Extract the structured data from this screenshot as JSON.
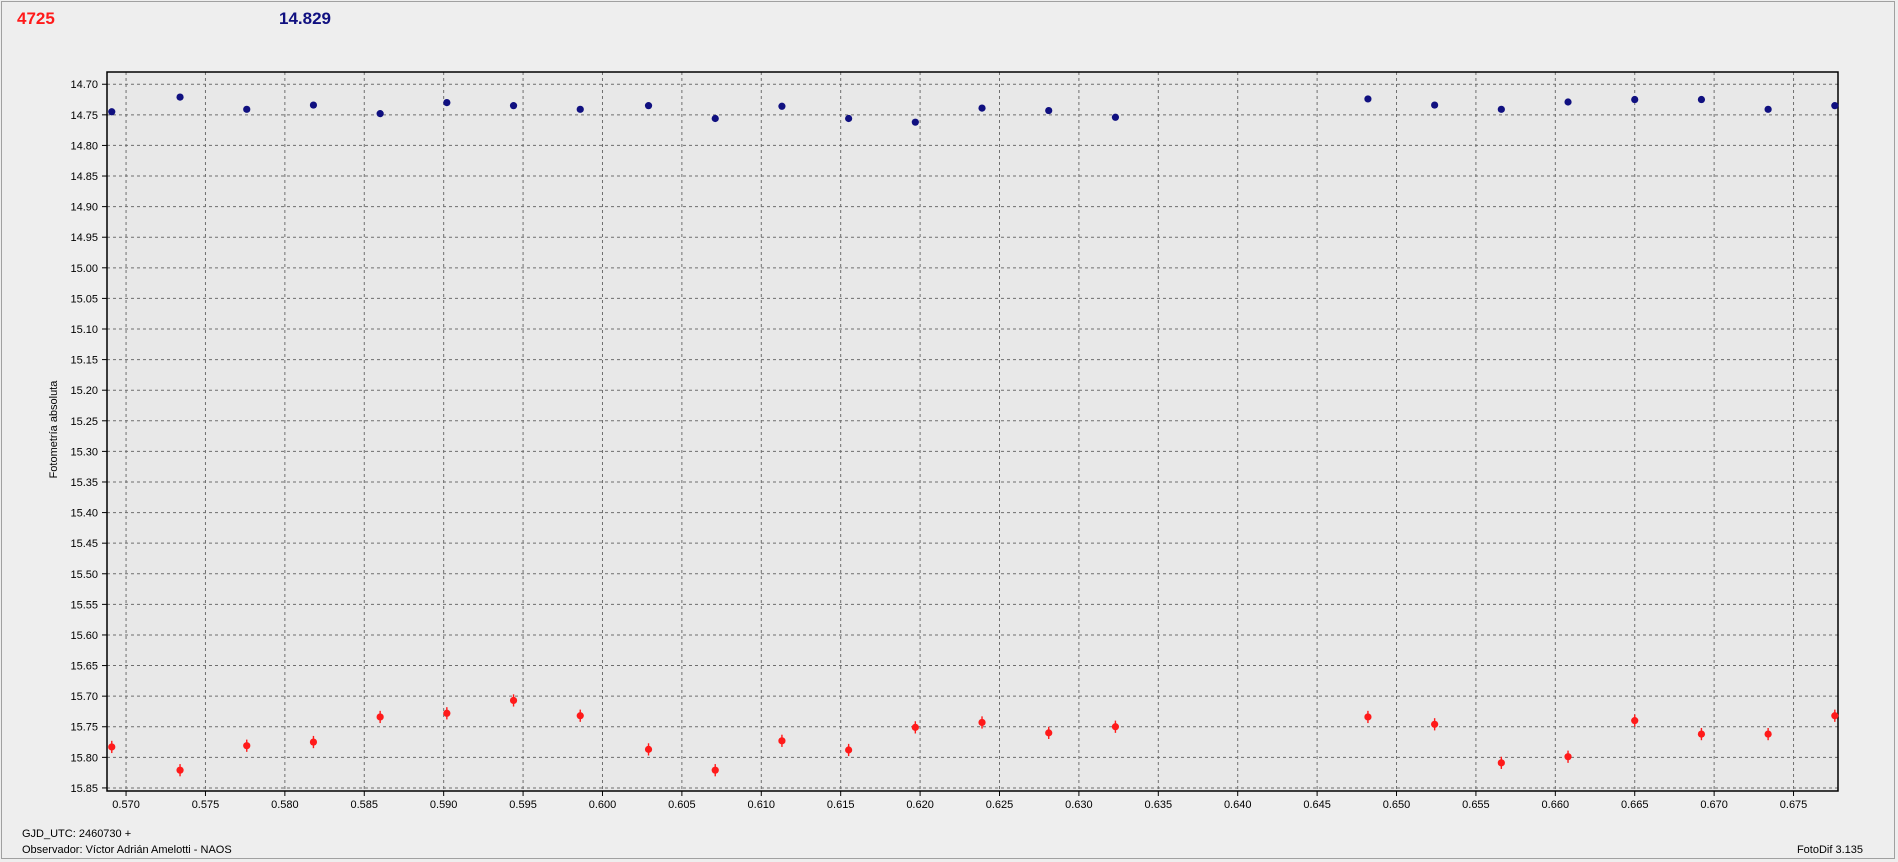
{
  "header": {
    "left_value": "4725",
    "right_value": "14.829"
  },
  "footer": {
    "time_label": "GJD_UTC: 2460730 +",
    "observer": "Observador: Víctor Adrián Amelotti - NAOS",
    "software": "FotoDif 3.135"
  },
  "colors": {
    "series1": "#101080",
    "series2": "#ff1a1a",
    "plot_bg": "#e8e8e8",
    "grid": "#6e6e6e"
  },
  "chart_data": {
    "type": "scatter",
    "title": "",
    "xlabel": "",
    "ylabel": "Fotometría absoluta",
    "xlim": [
      0.5688,
      0.6778
    ],
    "ylim": [
      14.68,
      15.855
    ],
    "y_inverted": true,
    "grid": true,
    "x_ticks": [
      "0.570",
      "0.575",
      "0.580",
      "0.585",
      "0.590",
      "0.595",
      "0.600",
      "0.605",
      "0.610",
      "0.615",
      "0.620",
      "0.625",
      "0.630",
      "0.635",
      "0.640",
      "0.645",
      "0.650",
      "0.655",
      "0.660",
      "0.665",
      "0.670",
      "0.675"
    ],
    "y_ticks": [
      "14.70",
      "14.75",
      "14.80",
      "14.85",
      "14.90",
      "14.95",
      "15.00",
      "15.05",
      "15.10",
      "15.15",
      "15.20",
      "15.25",
      "15.30",
      "15.35",
      "15.40",
      "15.45",
      "15.50",
      "15.55",
      "15.60",
      "15.65",
      "15.70",
      "15.75",
      "15.80",
      "15.85"
    ],
    "series": [
      {
        "color": "#101080",
        "x": [
          0.5691,
          0.5734,
          0.5776,
          0.5818,
          0.586,
          0.5902,
          0.5944,
          0.5986,
          0.6029,
          0.6071,
          0.6113,
          0.6155,
          0.6197,
          0.6239,
          0.6281,
          0.6323,
          0.6482,
          0.6524,
          0.6566,
          0.6608,
          0.665,
          0.6692,
          0.6734,
          0.6776
        ],
        "y": [
          14.745,
          14.721,
          14.741,
          14.734,
          14.748,
          14.73,
          14.735,
          14.741,
          14.735,
          14.756,
          14.736,
          14.756,
          14.762,
          14.739,
          14.743,
          14.754,
          14.724,
          14.734,
          14.741,
          14.729,
          14.725,
          14.725,
          14.741,
          14.735
        ],
        "err": [
          0.004,
          0.004,
          0.004,
          0.004,
          0.004,
          0.004,
          0.004,
          0.004,
          0.004,
          0.004,
          0.004,
          0.004,
          0.004,
          0.004,
          0.004,
          0.004,
          0.004,
          0.004,
          0.004,
          0.004,
          0.004,
          0.004,
          0.004,
          0.004
        ]
      },
      {
        "color": "#ff1a1a",
        "x": [
          0.5691,
          0.5734,
          0.5776,
          0.5818,
          0.586,
          0.5902,
          0.5944,
          0.5986,
          0.6029,
          0.6071,
          0.6113,
          0.6155,
          0.6197,
          0.6239,
          0.6281,
          0.6323,
          0.6482,
          0.6524,
          0.6566,
          0.6608,
          0.665,
          0.6692,
          0.6734,
          0.6776
        ],
        "y": [
          15.783,
          15.821,
          15.781,
          15.775,
          15.734,
          15.728,
          15.707,
          15.732,
          15.787,
          15.821,
          15.773,
          15.788,
          15.751,
          15.743,
          15.76,
          15.75,
          15.734,
          15.746,
          15.809,
          15.799,
          15.74,
          15.762,
          15.762,
          15.732
        ],
        "err": [
          0.01,
          0.01,
          0.01,
          0.01,
          0.01,
          0.01,
          0.01,
          0.01,
          0.01,
          0.01,
          0.01,
          0.01,
          0.01,
          0.01,
          0.01,
          0.01,
          0.01,
          0.01,
          0.01,
          0.01,
          0.01,
          0.01,
          0.01,
          0.01
        ]
      }
    ]
  }
}
